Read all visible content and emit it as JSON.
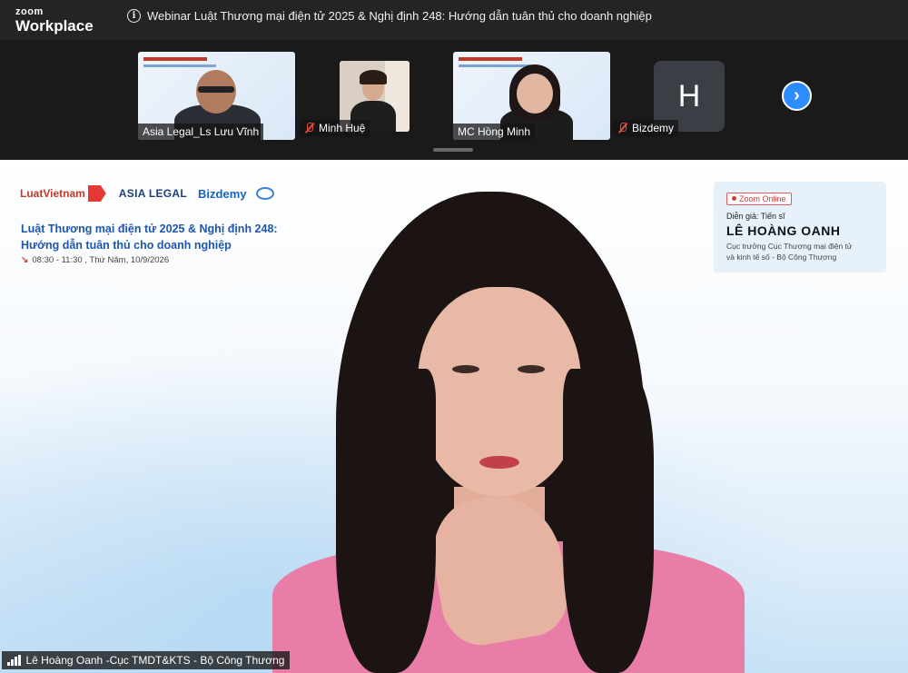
{
  "app": {
    "brand_top": "zoom",
    "brand_bottom": "Workplace"
  },
  "meeting": {
    "title": "Webinar Luật Thương mại điện tử 2025 & Nghị định 248: Hướng dẫn tuân thủ cho doanh nghiệp"
  },
  "participants": [
    {
      "name": "Asia Legal_Ls Lưu Vĩnh",
      "muted": false
    },
    {
      "name": "Minh Huệ",
      "muted": true
    },
    {
      "name": "MC Hồng Minh",
      "muted": false
    },
    {
      "name": "Bizdemy",
      "muted": true,
      "avatar_letter": "H"
    }
  ],
  "slide": {
    "brands": [
      "LuatVietnam",
      "ASIA LEGAL",
      "Bizdemy"
    ],
    "title_line1": "Luật Thương mại điện tử 2025 & Nghị định 248:",
    "title_line2": "Hướng dẫn tuân thủ cho doanh nghiệp",
    "time": "08:30 - 11:30 , Thứ Năm, 10/9/2026",
    "zoom_online": "Zoom Online",
    "speaker_label": "Diễn giả: Tiến sĩ",
    "speaker_name": "LÊ HOÀNG OANH",
    "speaker_role_line1": "Cục trưởng Cục Thương mại điện tử",
    "speaker_role_line2": "và kinh tế số - Bộ Công Thương"
  },
  "active_speaker": {
    "name": "Lê Hoàng Oanh -Cục TMDT&KTS - Bộ Công Thương"
  },
  "colors": {
    "accent": "#2d8cff",
    "title_blue": "#1e56b0",
    "mute_red": "#e74c3c",
    "jacket_pink": "#e87ea8"
  }
}
